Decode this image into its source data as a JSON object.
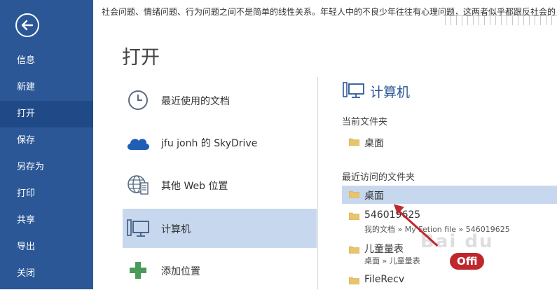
{
  "top_text": "社会问题、情绪问题、行为问题之间不是简单的线性关系。年轻人中的不良少年往往有心理问题，这两者似乎都跟反社会的",
  "sidebar": {
    "items": [
      {
        "label": "信息"
      },
      {
        "label": "新建"
      },
      {
        "label": "打开"
      },
      {
        "label": "保存"
      },
      {
        "label": "另存为"
      },
      {
        "label": "打印"
      },
      {
        "label": "共享"
      },
      {
        "label": "导出"
      },
      {
        "label": "关闭"
      }
    ]
  },
  "page_title": "打开",
  "locations": [
    {
      "label": "最近使用的文档",
      "icon": "clock-icon"
    },
    {
      "label": "jfu jonh 的 SkyDrive",
      "icon": "cloud-icon"
    },
    {
      "label": "其他 Web 位置",
      "icon": "globe-server-icon"
    },
    {
      "label": "计算机",
      "icon": "computer-icon"
    },
    {
      "label": "添加位置",
      "icon": "plus-icon"
    }
  ],
  "pane": {
    "title": "计算机",
    "current_folder_label": "当前文件夹",
    "current_folder": "桌面",
    "recent_label": "最近访问的文件夹",
    "recent": [
      {
        "name": "桌面",
        "path": ""
      },
      {
        "name": "546019625",
        "path": "我的文档 » My Fetion file » 546019625"
      },
      {
        "name": "儿童量表",
        "path": "桌面 » 儿童量表"
      },
      {
        "name": "FileRecv",
        "path": ""
      }
    ]
  },
  "watermark": {
    "badge": "Offi",
    "faint": "Bai du"
  },
  "colors": {
    "sidebar": "#2b5797",
    "selected": "#c7d8ee",
    "accent": "#2b5797",
    "arrow": "#c0272d"
  }
}
